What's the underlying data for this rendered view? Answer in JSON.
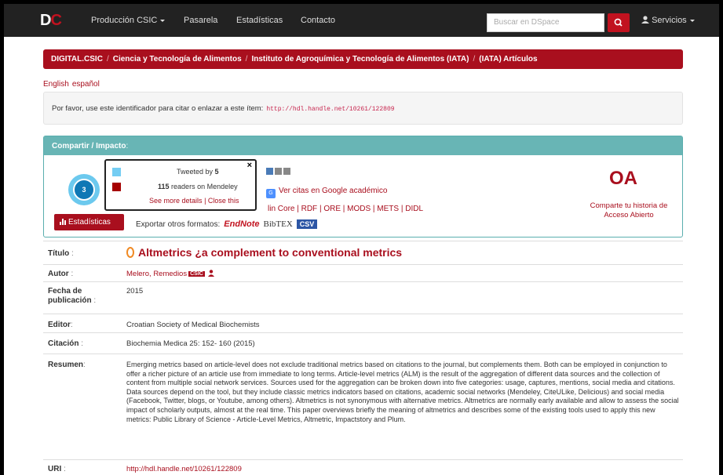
{
  "navbar": {
    "brand_d": "D",
    "brand_c": "C",
    "items": [
      {
        "label": "Producción CSIC"
      },
      {
        "label": "Pasarela"
      },
      {
        "label": "Estadísticas"
      },
      {
        "label": "Contacto"
      }
    ],
    "search_placeholder": "Buscar en DSpace",
    "user_menu": "Servicios"
  },
  "breadcrumb": [
    "DIGITAL.CSIC",
    "Ciencia y Tecnología de Alimentos",
    "Instituto de Agroquímica y Tecnología de Alimentos (IATA)",
    "(IATA) Artículos"
  ],
  "languages": [
    "English",
    "español"
  ],
  "handle": {
    "text": "Por favor, use este identificador para citar o enlazar a este ítem:",
    "url": "http://hdl.handle.net/10261/122809"
  },
  "share_panel": {
    "title": "Compartir / Impacto",
    "title_colon": ":",
    "altmetric_score": "3",
    "stats_button": "Estadísticas",
    "google_scholar": "Ver citas en Google académico",
    "formats": "lin Core | RDF | ORE | MODS | METS | DIDL",
    "export_label": "Exportar otros formatos:",
    "endnote": "EndNote",
    "bibtex": "BibTEX",
    "csv": "CSV",
    "oa_logo": "OA",
    "oa_text": "Comparte tu historia de Acceso Abierto"
  },
  "tooltip": {
    "tweeted_prefix": "Tweeted by",
    "tweeted_count": "5",
    "readers_count": "115",
    "readers_suffix": "readers on Mendeley",
    "more_details": "See more details",
    "separator": "|",
    "close_this": "Close this",
    "close_glyph": "×",
    "colors": {
      "twitter": "#74cdf3",
      "mendeley": "#a60000"
    }
  },
  "metadata": {
    "title_label": "Título",
    "title_value": "Altmetrics ¿a complement to conventional metrics",
    "author_label": "Autor",
    "author_value": "Melero, Remedios",
    "author_badge": "CSIC",
    "date_label": "Fecha de publicación",
    "date_value": "2015",
    "publisher_label": "Editor",
    "publisher_value": "Croatian Society of Medical Biochemists",
    "citation_label": "Citación",
    "citation_value": "Biochemia Medica 25: 152- 160 (2015)",
    "abstract_label": "Resumen",
    "abstract_value": "Emerging metrics based on article-level does not exclude traditional metrics based on citations to the journal, but complements them. Both can be employed in conjunction to offer a richer picture of an article use from immediate to long terms. Article-level metrics (ALM) is the result of the aggregation of different data sources and the collection of content from multiple social network services. Sources used for the aggregation can be broken down into five categories: usage, captures, mentions, social media and citations. Data sources depend on the tool, but they include classic metrics indicators based on citations, academic social networks (Mendeley, CiteULike, Delicious) and social media (Facebook, Twitter, blogs, or Youtube, among others). Altmetrics is not synonymous with alternative metrics. Altmetrics are normally early available and allow to assess the social impact of scholarly outputs, almost at the real time. This paper overviews briefly the meaning of altmetrics and describes some of the existing tools used to apply this new metrics: Public Library of Science - Article-Level Metrics, Altmetric, Impactstory and Plum.",
    "uri_label": "URI",
    "uri_value": "http://hdl.handle.net/10261/122809"
  },
  "colors": {
    "brand_red": "#a90f1e",
    "navbar": "#222222",
    "panel_teal": "#68b5b5"
  }
}
